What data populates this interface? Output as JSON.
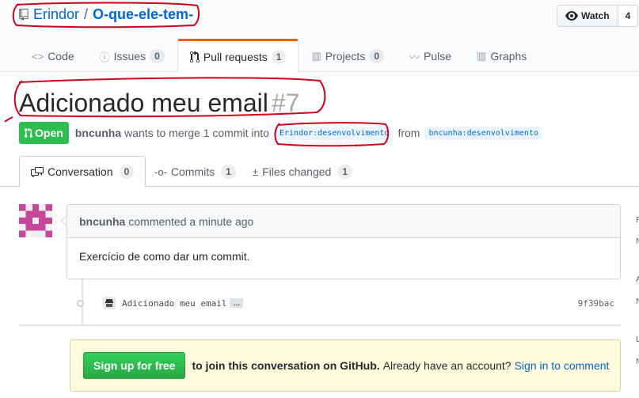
{
  "repo": {
    "owner": "Erindor",
    "separator": "/",
    "name": "O-que-ele-tem-"
  },
  "watch": {
    "label": "Watch",
    "count": "4"
  },
  "nav": [
    {
      "icon": "<>",
      "label": "Code",
      "count": ""
    },
    {
      "icon": "ⓘ",
      "label": "Issues",
      "count": "0"
    },
    {
      "icon": "pr",
      "label": "Pull requests",
      "count": "1"
    },
    {
      "icon": "▥",
      "label": "Projects",
      "count": "0"
    },
    {
      "icon": "〰",
      "label": "Pulse",
      "count": ""
    },
    {
      "icon": "▥",
      "label": "Graphs",
      "count": ""
    }
  ],
  "pr": {
    "title": "Adicionado meu email",
    "number": "#7",
    "state": "Open",
    "author": "bncunha",
    "merge_text": "wants to merge 1 commit into",
    "base_ref": "Erindor:desenvolvimento",
    "from_text": "from",
    "head_ref": "bncunha:desenvolvimento"
  },
  "tabs": [
    {
      "label": "Conversation",
      "count": "0"
    },
    {
      "label": "Commits",
      "count": "1"
    },
    {
      "label": "Files changed",
      "count": "1"
    }
  ],
  "comment": {
    "author": "bncunha",
    "meta": "commented a minute ago",
    "body": "Exercício de como dar um commit."
  },
  "commit": {
    "message": "Adicionado meu email",
    "ellipsis": "…",
    "sha": "9f39bac"
  },
  "signup": {
    "button": "Sign up for free",
    "bold_text": "to join this conversation on GitHub.",
    "text": "Already have an account?",
    "link": "Sign in to comment"
  },
  "sidebar_fragments": [
    "R",
    "N",
    "A",
    "N",
    "L",
    "N"
  ],
  "colors": {
    "accent": "#e36209",
    "open": "#2cbe4e",
    "link": "#0366d6",
    "annotation": "#d0021b"
  }
}
